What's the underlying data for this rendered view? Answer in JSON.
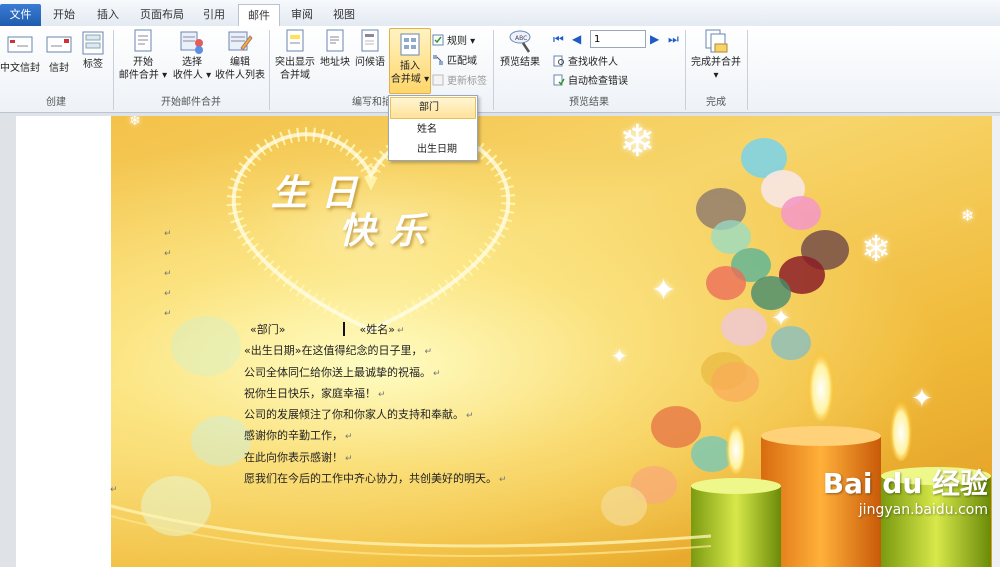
{
  "tabs": [
    {
      "label": "文件"
    },
    {
      "label": "开始"
    },
    {
      "label": "插入"
    },
    {
      "label": "页面布局"
    },
    {
      "label": "引用"
    },
    {
      "label": "邮件"
    },
    {
      "label": "审阅"
    },
    {
      "label": "视图"
    }
  ],
  "ribbon": {
    "create": {
      "label": "创建",
      "cn_envelope": "中文信封",
      "envelope": "信封",
      "labels": "标签"
    },
    "start_merge": {
      "label": "开始邮件合并",
      "start_line1": "开始",
      "start_line2": "邮件合并",
      "select_line1": "选择",
      "select_line2": "收件人",
      "edit_line1": "编辑",
      "edit_line2": "收件人列表"
    },
    "write_insert": {
      "label": "编写和插",
      "highlight_line1": "突出显示",
      "highlight_line2": "合并域",
      "address_block": "地址块",
      "greeting": "问候语",
      "insert_line1": "插入",
      "insert_line2": "合并域",
      "rules": "规则",
      "match_fields": "匹配域",
      "update_labels": "更新标签"
    },
    "preview": {
      "label": "预览结果",
      "preview_results": "预览结果",
      "record_number": "1",
      "find_recipient": "查找收件人",
      "auto_check": "自动检查错误"
    },
    "finish": {
      "label": "完成",
      "finish_merge": "完成并合并"
    }
  },
  "dropdown": {
    "items": [
      "部门",
      "姓名",
      "出生日期"
    ]
  },
  "card": {
    "title_line1": "生日",
    "title_line2": "快乐"
  },
  "letter": {
    "field_department": "«部门»",
    "field_name": "«姓名»",
    "line1_field": "«出生日期»",
    "line1_text": "在这值得纪念的日子里，",
    "line2": "公司全体同仁给你送上最诚挚的祝福。",
    "line3": "祝你生日快乐，家庭幸福！",
    "line4": "公司的发展倾注了你和你家人的支持和奉献。",
    "line5": "感谢你的辛勤工作，",
    "line6": "在此向你表示感谢！",
    "line7": "愿我们在今后的工作中齐心协力，共创美好的明天。",
    "paragraph_mark": "↵"
  },
  "watermark": {
    "brand": "Bai du 经验",
    "url": "jingyan.baidu.com"
  },
  "colors": {
    "file_tab": "#1f5cae",
    "insert_highlight": "#ffd66b",
    "card_gold": "#f0b938"
  }
}
